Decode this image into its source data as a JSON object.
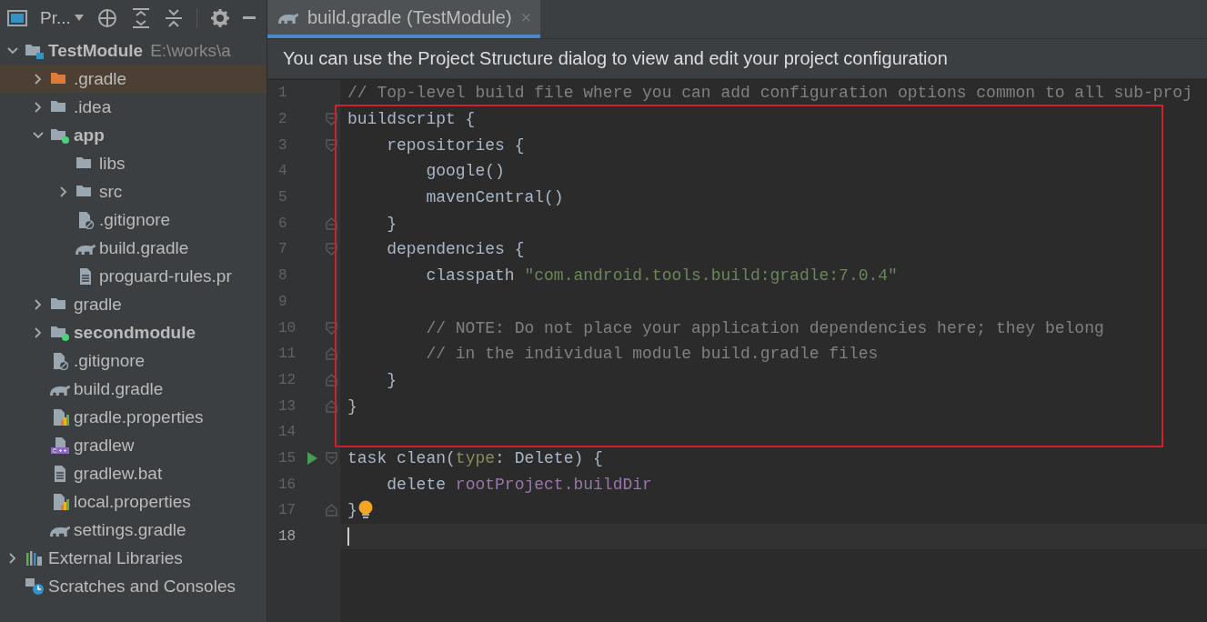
{
  "toolbar": {
    "view_label": "Pr..."
  },
  "tree": [
    {
      "label": "TestModule",
      "kind": "project",
      "bold": true,
      "hint": "E:\\works\\a",
      "expanded": true,
      "selected": false,
      "children": [
        {
          "label": ".gradle",
          "kind": "excluded-folder",
          "expanded": false,
          "selected": true
        },
        {
          "label": ".idea",
          "kind": "folder",
          "expanded": false,
          "selected": false
        },
        {
          "label": "app",
          "kind": "module",
          "bold": true,
          "expanded": true,
          "selected": false,
          "children": [
            {
              "label": "libs",
              "kind": "folder",
              "selected": false
            },
            {
              "label": "src",
              "kind": "folder",
              "expanded": false,
              "selected": false
            },
            {
              "label": ".gitignore",
              "kind": "ignore-file",
              "selected": false
            },
            {
              "label": "build.gradle",
              "kind": "gradle",
              "selected": false
            },
            {
              "label": "proguard-rules.pr",
              "kind": "text",
              "selected": false
            }
          ]
        },
        {
          "label": "gradle",
          "kind": "folder",
          "expanded": false,
          "selected": false
        },
        {
          "label": "secondmodule",
          "kind": "module",
          "bold": true,
          "expanded": false,
          "selected": false
        },
        {
          "label": ".gitignore",
          "kind": "ignore-file",
          "selected": false
        },
        {
          "label": "build.gradle",
          "kind": "gradle",
          "selected": false
        },
        {
          "label": "gradle.properties",
          "kind": "properties",
          "selected": false
        },
        {
          "label": "gradlew",
          "kind": "script",
          "selected": false
        },
        {
          "label": "gradlew.bat",
          "kind": "text",
          "selected": false
        },
        {
          "label": "local.properties",
          "kind": "properties",
          "selected": false
        },
        {
          "label": "settings.gradle",
          "kind": "gradle",
          "selected": false
        }
      ]
    },
    {
      "label": "External Libraries",
      "kind": "libraries",
      "expanded": false,
      "selected": false
    },
    {
      "label": "Scratches and Consoles",
      "kind": "scratches",
      "selected": false
    }
  ],
  "tabs": [
    {
      "label": "build.gradle (TestModule)",
      "close": "×",
      "selected": true
    }
  ],
  "banner": "You can use the Project Structure dialog to view and edit your project configuration",
  "code_blocks": [
    {
      "highlighted": false,
      "lines": [
        {
          "num": "1",
          "segments": [
            {
              "text": "// Top-level build file where you can add configuration options common to all sub-proj",
              "kind": "comment"
            }
          ]
        }
      ]
    },
    {
      "highlighted": true,
      "lines": [
        {
          "num": "2",
          "fold_start": true,
          "segments": [
            {
              "text": "buildscript {",
              "kind": "plain"
            }
          ]
        },
        {
          "num": "3",
          "fold_start": true,
          "segments": [
            {
              "text": "    repositories {",
              "kind": "plain"
            }
          ]
        },
        {
          "num": "4",
          "segments": [
            {
              "text": "        google()",
              "kind": "plain"
            }
          ]
        },
        {
          "num": "5",
          "segments": [
            {
              "text": "        mavenCentral()",
              "kind": "plain"
            }
          ]
        },
        {
          "num": "6",
          "fold_end": true,
          "segments": [
            {
              "text": "    }",
              "kind": "plain"
            }
          ]
        },
        {
          "num": "7",
          "fold_start": true,
          "segments": [
            {
              "text": "    dependencies {",
              "kind": "plain"
            }
          ]
        },
        {
          "num": "8",
          "segments": [
            {
              "text": "        classpath ",
              "kind": "plain"
            },
            {
              "text": "\"com.android.tools.build:gradle:7.0.4\"",
              "kind": "string"
            }
          ]
        },
        {
          "num": "9"
        },
        {
          "num": "10",
          "fold_start": true,
          "segments": [
            {
              "text": "        // NOTE: Do not place your application dependencies here; they belong",
              "kind": "comment"
            }
          ]
        },
        {
          "num": "11",
          "fold_end": true,
          "segments": [
            {
              "text": "        // in the individual module build.gradle files",
              "kind": "comment"
            }
          ]
        },
        {
          "num": "12",
          "fold_end": true,
          "segments": [
            {
              "text": "    }",
              "kind": "plain"
            }
          ]
        },
        {
          "num": "13",
          "fold_end": true,
          "segments": [
            {
              "text": "}",
              "kind": "plain"
            }
          ]
        },
        {
          "num": "14"
        }
      ]
    },
    {
      "highlighted": false,
      "lines": [
        {
          "num": "15",
          "run": true,
          "fold_start": true,
          "segments": [
            {
              "text": "task clean(",
              "kind": "plain"
            },
            {
              "text": "type",
              "kind": "named-arg"
            },
            {
              "text": ": Delete) {",
              "kind": "plain"
            }
          ]
        },
        {
          "num": "16",
          "segments": [
            {
              "text": "    delete ",
              "kind": "plain"
            },
            {
              "text": "rootProject.buildDir",
              "kind": "property"
            }
          ]
        },
        {
          "num": "17",
          "fold_end": true,
          "bulb": true,
          "segments": [
            {
              "text": "}",
              "kind": "plain"
            }
          ]
        },
        {
          "num": "18",
          "current": true
        }
      ]
    }
  ]
}
